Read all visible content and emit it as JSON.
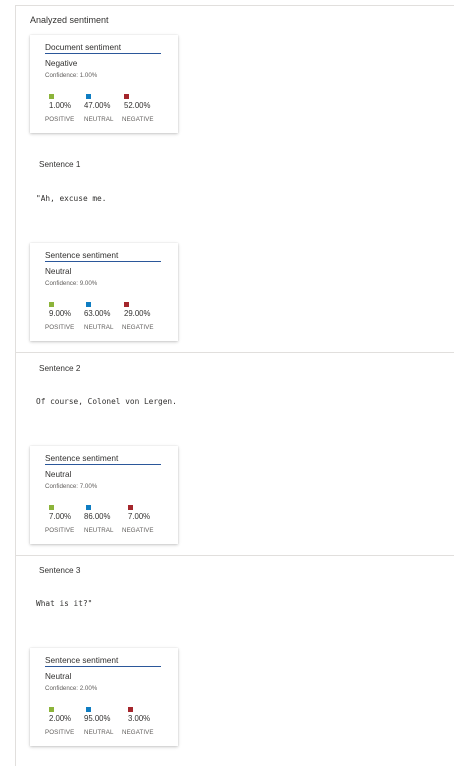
{
  "title": "Analyzed sentiment",
  "colors": {
    "positive": "#8cb43a",
    "neutral": "#0f7dc2",
    "negative": "#a4262c",
    "heading_rule": "#2b579a"
  },
  "labels": {
    "positive": "POSITIVE",
    "neutral": "NEUTRAL",
    "negative": "NEGATIVE"
  },
  "document": {
    "heading": "Document sentiment",
    "label": "Negative",
    "confidence": "Confidence: 1.00%",
    "positive": "1.00%",
    "neutral": "47.00%",
    "negative": "52.00%"
  },
  "sentences": [
    {
      "title": "Sentence 1",
      "text": "\"Ah, excuse me.",
      "card": {
        "heading": "Sentence sentiment",
        "label": "Neutral",
        "confidence": "Confidence: 9.00%",
        "positive": "9.00%",
        "neutral": "63.00%",
        "negative": "29.00%"
      }
    },
    {
      "title": "Sentence 2",
      "text": "Of course, Colonel von Lergen.",
      "card": {
        "heading": "Sentence sentiment",
        "label": "Neutral",
        "confidence": "Confidence: 7.00%",
        "positive": "7.00%",
        "neutral": "86.00%",
        "negative": "7.00%"
      }
    },
    {
      "title": "Sentence 3",
      "text": "What is it?\"",
      "card": {
        "heading": "Sentence sentiment",
        "label": "Neutral",
        "confidence": "Confidence: 2.00%",
        "positive": "2.00%",
        "neutral": "95.00%",
        "negative": "3.00%"
      }
    }
  ]
}
